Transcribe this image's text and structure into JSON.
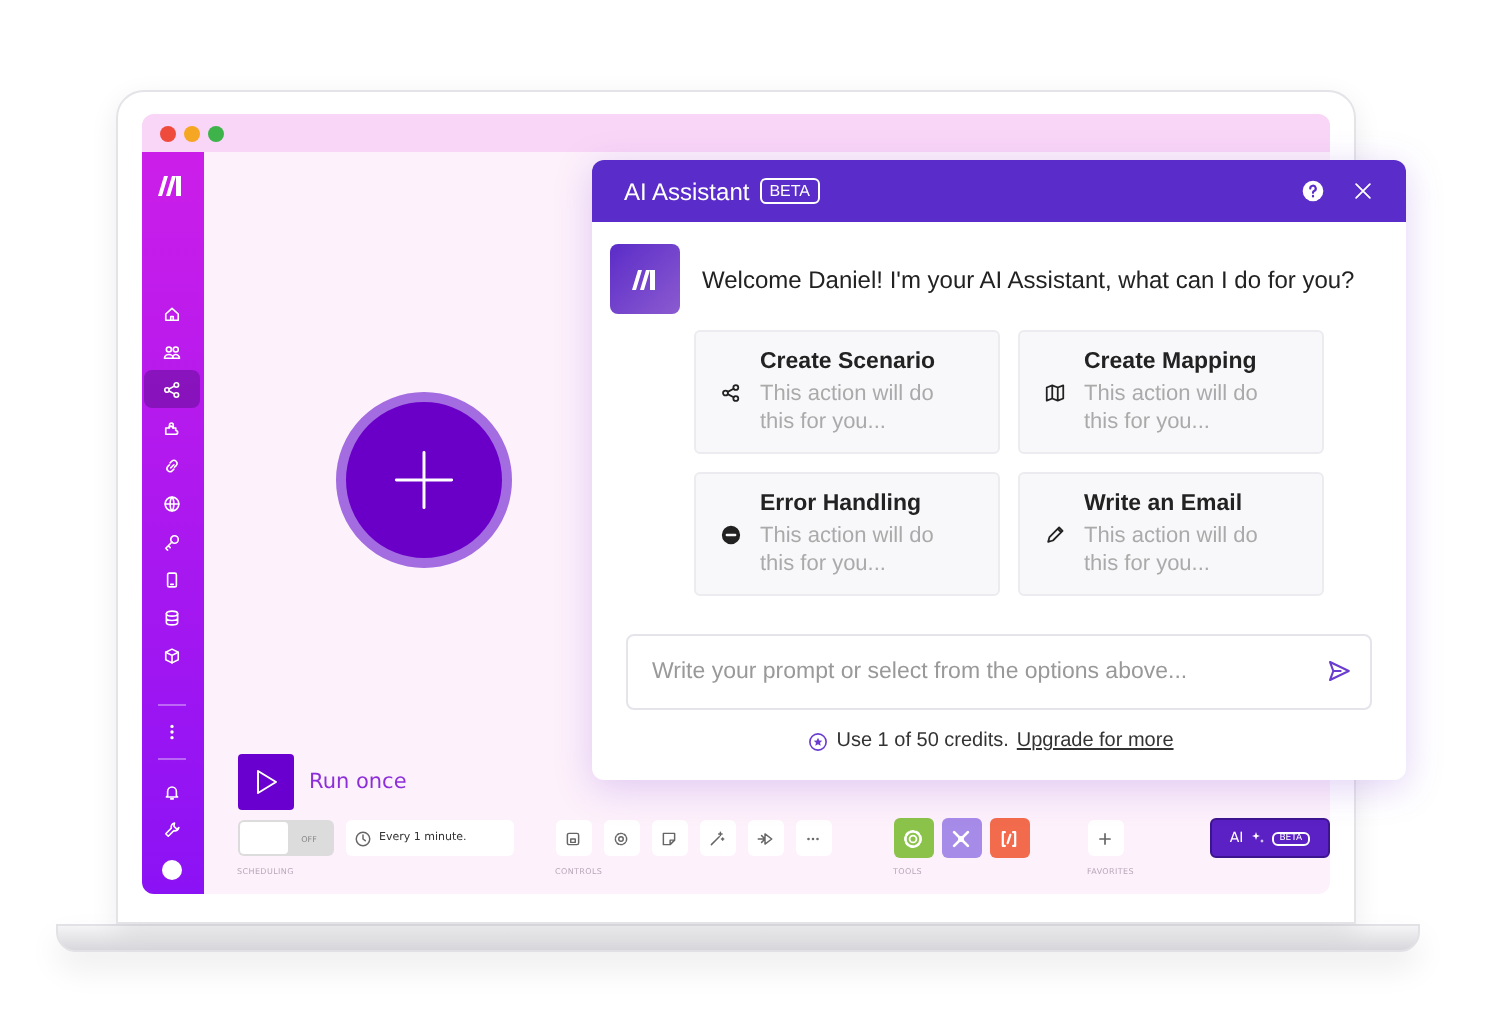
{
  "sidebar": {
    "items": [
      {
        "selected": false
      },
      {
        "selected": false
      },
      {
        "selected": true
      },
      {
        "selected": false
      },
      {
        "selected": false
      },
      {
        "selected": false
      },
      {
        "selected": false
      },
      {
        "selected": false
      },
      {
        "selected": false
      },
      {
        "selected": false
      }
    ]
  },
  "canvas": {
    "run_button": "Run once",
    "scheduling": {
      "on": false,
      "toggle_label": "OFF",
      "interval": "Every 1 minute.",
      "caption": "SCHEDULING"
    },
    "controls_caption": "CONTROLS",
    "tools": [
      {
        "color": "#8bc34a"
      },
      {
        "color": "#a78be8"
      },
      {
        "color": "#f26b4c"
      }
    ],
    "tools_caption": "TOOLS",
    "favorites_caption": "FAVORITES",
    "ai_button": {
      "label": "AI",
      "badge": "BETA"
    }
  },
  "assistant": {
    "title": "AI Assistant",
    "badge": "BETA",
    "greeting": "Welcome Daniel! I'm your AI Assistant, what can I do for you?",
    "actions": [
      {
        "title": "Create Scenario",
        "description": "This action will do this for you..."
      },
      {
        "title": "Create Mapping",
        "description": "This action will do this for you..."
      },
      {
        "title": "Error Handling",
        "description": "This action will do this for you..."
      },
      {
        "title": "Write an Email",
        "description": "This action will do this for you..."
      }
    ],
    "prompt": {
      "placeholder": "Write your prompt or select from the options above..."
    },
    "credits": "Use 1 of 50 credits.",
    "upgrade_link": "Upgrade for more"
  }
}
